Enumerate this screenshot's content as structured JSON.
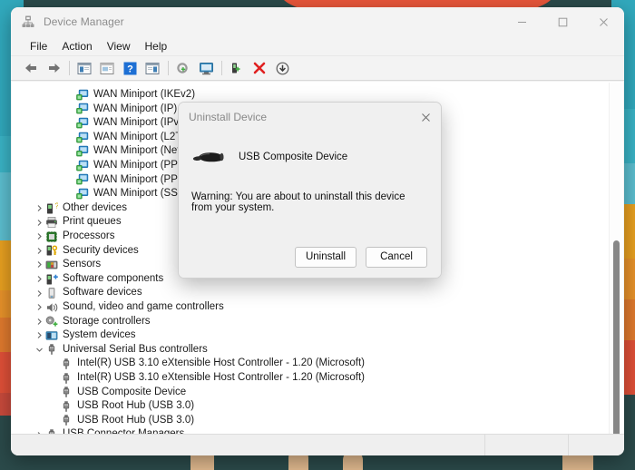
{
  "window": {
    "title": "Device Manager",
    "app_icon": "device-manager-icon",
    "controls": {
      "minimize": "–",
      "maximize": "☐",
      "close": "✕"
    }
  },
  "menubar": {
    "items": [
      {
        "label": "File"
      },
      {
        "label": "Action"
      },
      {
        "label": "View"
      },
      {
        "label": "Help"
      }
    ]
  },
  "toolbar": {
    "buttons": [
      {
        "name": "back-icon",
        "glyph": "←"
      },
      {
        "name": "forward-icon",
        "glyph": "→"
      },
      {
        "name": "show-hide-console-tree-icon",
        "glyph": "▤"
      },
      {
        "name": "properties-icon",
        "glyph": "▣"
      },
      {
        "name": "help-icon",
        "glyph": "?"
      },
      {
        "name": "show-hide-action-pane-icon",
        "glyph": "▥"
      },
      {
        "name": "update-driver-icon",
        "glyph": "⚙"
      },
      {
        "name": "scan-for-hardware-changes-icon",
        "glyph": "⬜"
      },
      {
        "name": "uninstall-device-icon",
        "glyph": "⬛"
      },
      {
        "name": "disable-device-icon",
        "glyph": "✕"
      },
      {
        "name": "enable-device-icon",
        "glyph": "↓"
      }
    ]
  },
  "tree": {
    "rows": [
      {
        "label": "WAN Miniport (IKEv2)",
        "indent": 3,
        "twisty": "",
        "icon": "network-adapter-icon"
      },
      {
        "label": "WAN Miniport (IP)",
        "indent": 3,
        "twisty": "",
        "icon": "network-adapter-icon"
      },
      {
        "label": "WAN Miniport (IPv6)",
        "indent": 3,
        "twisty": "",
        "icon": "network-adapter-icon"
      },
      {
        "label": "WAN Miniport (L2TP)",
        "indent": 3,
        "twisty": "",
        "icon": "network-adapter-icon"
      },
      {
        "label": "WAN Miniport (Network Monitor)",
        "indent": 3,
        "twisty": "",
        "icon": "network-adapter-icon"
      },
      {
        "label": "WAN Miniport (PPPOE)",
        "indent": 3,
        "twisty": "",
        "icon": "network-adapter-icon"
      },
      {
        "label": "WAN Miniport (PPTP)",
        "indent": 3,
        "twisty": "",
        "icon": "network-adapter-icon"
      },
      {
        "label": "WAN Miniport (SSTP)",
        "indent": 3,
        "twisty": "",
        "icon": "network-adapter-icon"
      },
      {
        "label": "Other devices",
        "indent": 1,
        "twisty": "›",
        "icon": "other-devices-icon"
      },
      {
        "label": "Print queues",
        "indent": 1,
        "twisty": "›",
        "icon": "printer-icon"
      },
      {
        "label": "Processors",
        "indent": 1,
        "twisty": "›",
        "icon": "processor-icon"
      },
      {
        "label": "Security devices",
        "indent": 1,
        "twisty": "›",
        "icon": "security-device-icon"
      },
      {
        "label": "Sensors",
        "indent": 1,
        "twisty": "›",
        "icon": "sensor-icon"
      },
      {
        "label": "Software components",
        "indent": 1,
        "twisty": "›",
        "icon": "software-component-icon"
      },
      {
        "label": "Software devices",
        "indent": 1,
        "twisty": "›",
        "icon": "software-device-icon"
      },
      {
        "label": "Sound, video and game controllers",
        "indent": 1,
        "twisty": "›",
        "icon": "sound-controller-icon"
      },
      {
        "label": "Storage controllers",
        "indent": 1,
        "twisty": "›",
        "icon": "storage-controller-icon"
      },
      {
        "label": "System devices",
        "indent": 1,
        "twisty": "›",
        "icon": "system-device-icon"
      },
      {
        "label": "Universal Serial Bus controllers",
        "indent": 1,
        "twisty": "⌄",
        "icon": "usb-controller-icon"
      },
      {
        "label": "Intel(R) USB 3.10 eXtensible Host Controller - 1.20 (Microsoft)",
        "indent": 2,
        "twisty": "",
        "icon": "usb-device-icon"
      },
      {
        "label": "Intel(R) USB 3.10 eXtensible Host Controller - 1.20 (Microsoft)",
        "indent": 2,
        "twisty": "",
        "icon": "usb-device-icon"
      },
      {
        "label": "USB Composite Device",
        "indent": 2,
        "twisty": "",
        "icon": "usb-device-icon"
      },
      {
        "label": "USB Root Hub (USB 3.0)",
        "indent": 2,
        "twisty": "",
        "icon": "usb-device-icon"
      },
      {
        "label": "USB Root Hub (USB 3.0)",
        "indent": 2,
        "twisty": "",
        "icon": "usb-device-icon"
      },
      {
        "label": "USB Connector Managers",
        "indent": 1,
        "twisty": "›",
        "icon": "usb-controller-icon"
      }
    ]
  },
  "statusbar": {
    "main": "",
    "secondary": "",
    "tertiary": ""
  },
  "dialog": {
    "title": "Uninstall Device",
    "close_glyph": "✕",
    "device_icon": "usb-plug-icon",
    "device_name": "USB Composite Device",
    "warning": "Warning: You are about to uninstall this device from your system.",
    "buttons": {
      "confirm": "Uninstall",
      "cancel": "Cancel"
    }
  },
  "colors": {
    "wallpaper_teal": "#31a9bd",
    "wallpaper_orange": "#e8a020",
    "wallpaper_red": "#e8563a",
    "wallpaper_dark": "#2b4a4a",
    "window_chrome": "#f3f3f3",
    "accent_blue": "#1d6fd4"
  }
}
